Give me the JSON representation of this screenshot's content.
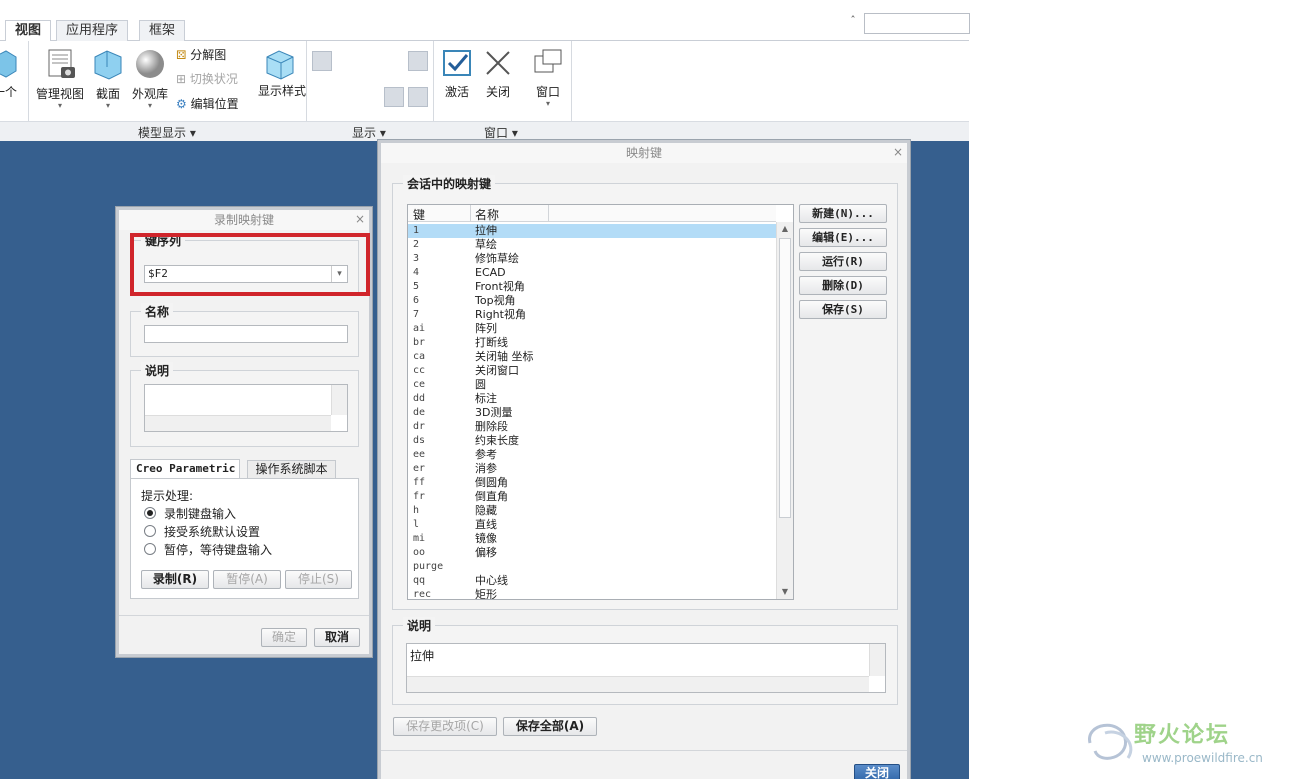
{
  "ribbon": {
    "tabs": [
      "视图",
      "应用程序",
      "框架"
    ],
    "active_tab": "视图",
    "left_cut_label": "一个",
    "buttons": {
      "manage_view": "管理视图",
      "section": "截面",
      "appearance": "外观库",
      "explode": "分解图",
      "toggle_state": "切换状况",
      "edit_position": "编辑位置",
      "display_style": "显示样式",
      "activate": "激活",
      "close": "关闭",
      "window": "窗口"
    },
    "groups": {
      "model_display": "模型显示",
      "display": "显示",
      "window": "窗口"
    },
    "dropdown_glyph": "▾",
    "help_glyph": "ˆ"
  },
  "record_dialog": {
    "title": "录制映射键",
    "close_glyph": "×",
    "key_sequence_label": "键序列",
    "key_sequence_value": "$F2",
    "name_label": "名称",
    "name_value": "",
    "desc_label": "说明",
    "tabs": [
      "Creo Parametric",
      "操作系统脚本"
    ],
    "prompt_label": "提示处理:",
    "options": [
      {
        "label": "录制键盘输入",
        "checked": true
      },
      {
        "label": "接受系统默认设置",
        "checked": false
      },
      {
        "label": "暂停，等待键盘输入",
        "checked": false
      }
    ],
    "record_button": "录制(R)",
    "pause_button": "暂停(A)",
    "stop_button": "停止(S)",
    "ok_button": "确定",
    "cancel_button": "取消"
  },
  "mapkey_dialog": {
    "title": "映射键",
    "close_glyph": "×",
    "session_label": "会话中的映射键",
    "columns": [
      "键",
      "名称"
    ],
    "rows": [
      {
        "key": "1",
        "name": "拉伸",
        "selected": true
      },
      {
        "key": "2",
        "name": "草绘"
      },
      {
        "key": "3",
        "name": "修饰草绘"
      },
      {
        "key": "4",
        "name": "ECAD"
      },
      {
        "key": "5",
        "name": "Front视角"
      },
      {
        "key": "6",
        "name": "Top视角"
      },
      {
        "key": "7",
        "name": "Right视角"
      },
      {
        "key": "ai",
        "name": "阵列"
      },
      {
        "key": "br",
        "name": "打断线"
      },
      {
        "key": "ca",
        "name": "关闭轴 坐标"
      },
      {
        "key": "cc",
        "name": "关闭窗口"
      },
      {
        "key": "ce",
        "name": "圆"
      },
      {
        "key": "dd",
        "name": "标注"
      },
      {
        "key": "de",
        "name": "3D测量"
      },
      {
        "key": "dr",
        "name": "删除段"
      },
      {
        "key": "ds",
        "name": "约束长度"
      },
      {
        "key": "ee",
        "name": "参考"
      },
      {
        "key": "er",
        "name": "消参"
      },
      {
        "key": "ff",
        "name": "倒圆角"
      },
      {
        "key": "fr",
        "name": "倒直角"
      },
      {
        "key": "h",
        "name": "隐藏"
      },
      {
        "key": "l",
        "name": "直线"
      },
      {
        "key": "mi",
        "name": "镜像"
      },
      {
        "key": "oo",
        "name": "偏移"
      },
      {
        "key": "purge",
        "name": ""
      },
      {
        "key": "qq",
        "name": "中心线"
      },
      {
        "key": "rec",
        "name": "矩形"
      }
    ],
    "new_button": "新建(N)...",
    "edit_button": "编辑(E)...",
    "run_button": "运行(R)",
    "delete_button": "删除(D)",
    "save_button": "保存(S)",
    "desc_label": "说明",
    "desc_value": "拉伸",
    "save_changed_button": "保存更改项(C)",
    "save_all_button": "保存全部(A)",
    "close_button": "关闭"
  },
  "watermark": {
    "title": "野火论坛",
    "url": "www.proewildfire.cn"
  },
  "colors": {
    "workspace": "#365f8e",
    "highlight_box": "#d0252b",
    "selected_row": "#b3dcf7"
  }
}
